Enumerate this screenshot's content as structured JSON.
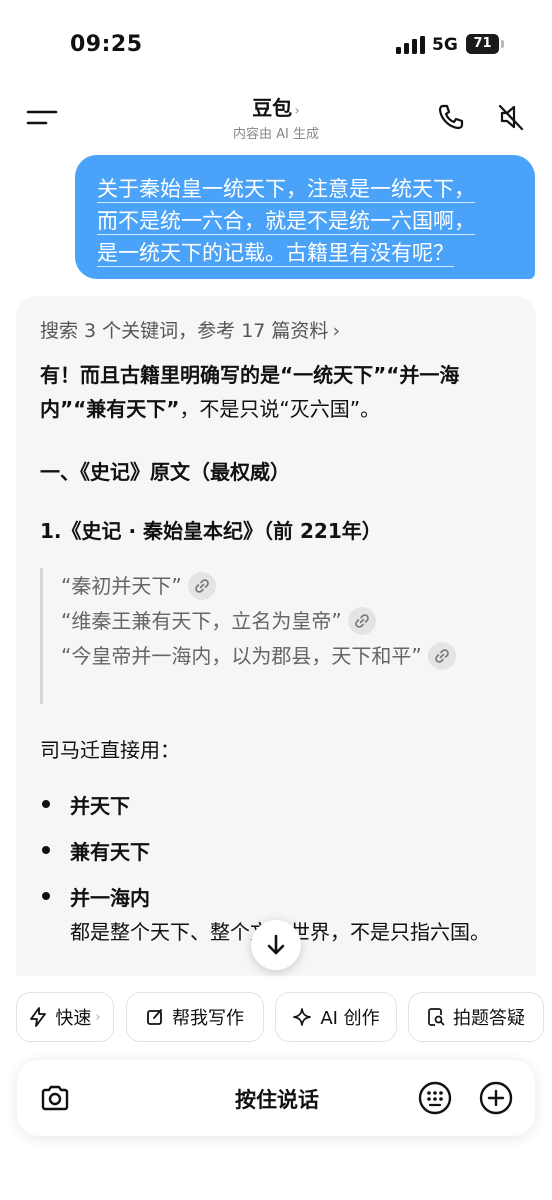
{
  "status_bar": {
    "time": "09:25",
    "network": "5G",
    "battery": "71"
  },
  "header": {
    "title": "豆包",
    "title_chevron": "›",
    "subtitle": "内容由 AI 生成"
  },
  "user_message": {
    "line1": "关于秦始皇一统天下，注意是一统天下，",
    "line2": "而不是统一六合，就是不是统一六国啊，",
    "line3": "是一统天下的记载。古籍里有没有呢？"
  },
  "answer": {
    "search_ref": "搜索 3 个关键词，参考 17 篇资料",
    "search_ref_chevron": "›",
    "intro_1": "有！而且",
    "intro_2": "古籍里明确写的是“一统天下”“并一海内”“兼有天下”",
    "intro_3": "，不是只说“灭六国”。",
    "heading_1": "一、《史记》原文（最权威）",
    "subheading_1": "1.《史记 · 秦始皇本纪》（前 221年）",
    "quotes": [
      "“秦初并天下”",
      "“维秦王兼有天下，立名为皇帝”",
      "“今皇帝并一海内，以为郡县，天下和平”"
    ],
    "lead": "司马迁直接用：",
    "bullets": [
      "并天下",
      "兼有天下",
      "并一海内"
    ],
    "bullet_desc": "都是整个天下、整个文明世界，不是只指六国。"
  },
  "quick_actions": {
    "fast": "快速",
    "fast_chevron": "›",
    "write": "帮我写作",
    "ai_create": "AI 创作",
    "photo_qa": "拍题答疑"
  },
  "input": {
    "hold_to_talk": "按住说话"
  }
}
